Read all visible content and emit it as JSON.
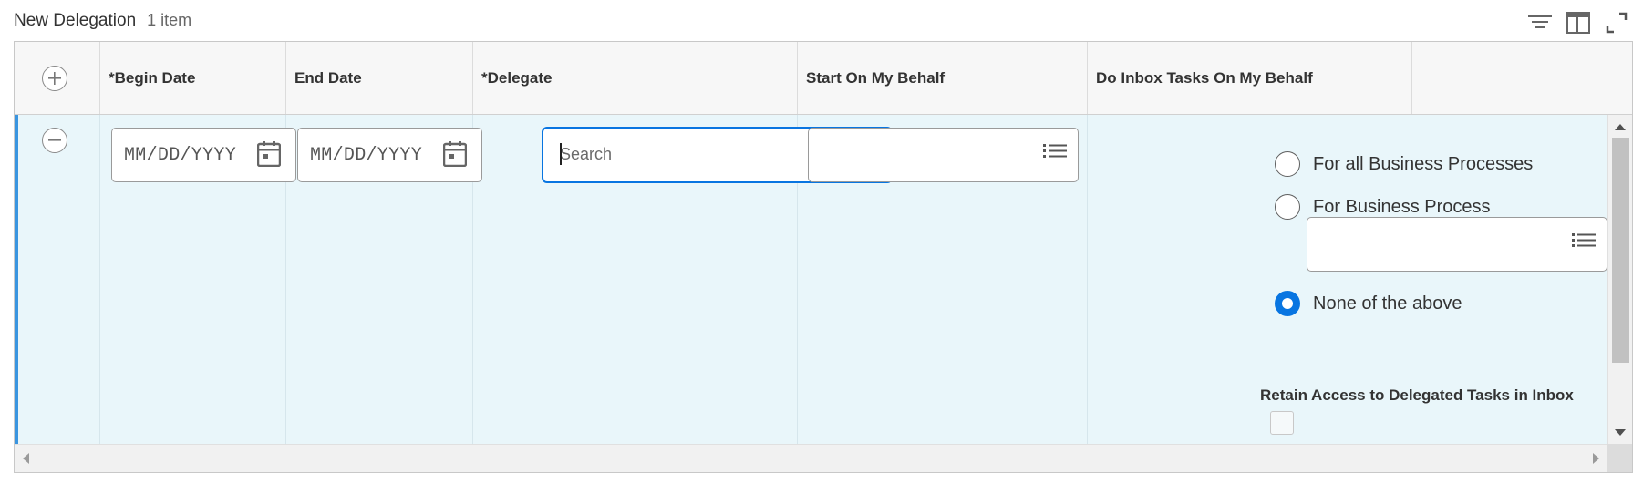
{
  "header": {
    "title": "New Delegation",
    "count": "1 item"
  },
  "toolbar": {
    "icons": [
      "filter-icon",
      "columns-icon",
      "fullscreen-icon"
    ]
  },
  "columns": [
    "*Begin Date",
    "End Date",
    "*Delegate",
    "Start On My Behalf",
    "Do Inbox Tasks On My Behalf"
  ],
  "row": {
    "begin_date": {
      "placeholder": "MM/DD/YYYY"
    },
    "end_date": {
      "placeholder": "MM/DD/YYYY"
    },
    "delegate": {
      "placeholder": "Search",
      "value": ""
    },
    "start_on_behalf": {
      "value": ""
    },
    "inbox_tasks": {
      "options": [
        {
          "label": "For all Business Processes",
          "checked": false
        },
        {
          "label": "For Business Process",
          "checked": false
        },
        {
          "label": "None of the above",
          "checked": true
        }
      ],
      "business_process_value": ""
    },
    "retain_access": {
      "label": "Retain Access to Delegated Tasks in Inbox",
      "checked": false
    }
  },
  "colors": {
    "accent": "#0875e1",
    "row_bg": "#e9f6fa",
    "row_marker": "#3a95e0"
  }
}
